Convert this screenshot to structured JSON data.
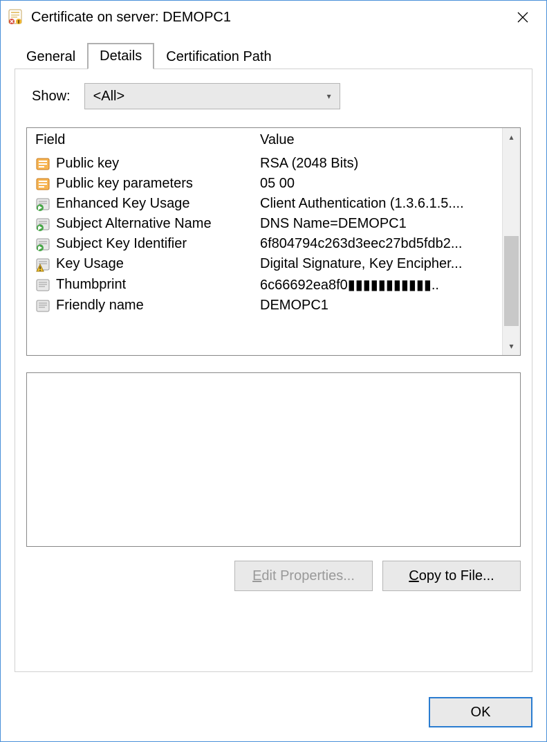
{
  "window": {
    "title": "Certificate on server: DEMOPC1"
  },
  "tabs": {
    "general": "General",
    "details": "Details",
    "certpath": "Certification Path"
  },
  "show": {
    "label": "Show:",
    "selected": "<All>"
  },
  "columns": {
    "field": "Field",
    "value": "Value"
  },
  "rows": [
    {
      "icon": "cert-ext-orange",
      "field": "Public key",
      "value": "RSA (2048 Bits)"
    },
    {
      "icon": "cert-ext-orange",
      "field": "Public key parameters",
      "value": "05 00"
    },
    {
      "icon": "cert-ext-green",
      "field": "Enhanced Key Usage",
      "value": "Client Authentication (1.3.6.1.5...."
    },
    {
      "icon": "cert-ext-green",
      "field": "Subject Alternative Name",
      "value": "DNS Name=DEMOPC1"
    },
    {
      "icon": "cert-ext-green",
      "field": "Subject Key Identifier",
      "value": "6f804794c263d3eec27bd5fdb2..."
    },
    {
      "icon": "cert-ext-warn",
      "field": "Key Usage",
      "value": "Digital Signature, Key Encipher..."
    },
    {
      "icon": "cert-ext-plain",
      "field": "Thumbprint",
      "value": "6c66692ea8f0▮▮▮▮▮▮▮▮▮▮▮.."
    },
    {
      "icon": "cert-ext-plain",
      "field": "Friendly name",
      "value": "DEMOPC1"
    }
  ],
  "detail_text": "",
  "buttons": {
    "edit_properties_prefix": "E",
    "edit_properties_rest": "dit Properties...",
    "copy_prefix": "C",
    "copy_rest": "opy to File...",
    "ok": "OK"
  }
}
